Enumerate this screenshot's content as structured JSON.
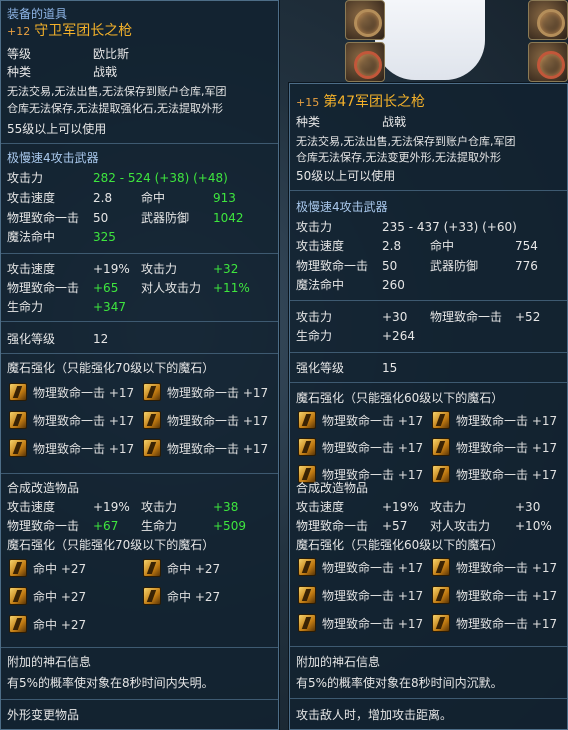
{
  "left": {
    "section_title": "装备的道具",
    "plus": "+12",
    "name": "守卫军团长之枪",
    "grade_label": "等级",
    "grade_value": "欧比斯",
    "type_label": "种类",
    "type_value": "战戟",
    "desc1": "无法交易,无法出售,无法保存到账户仓库,军团",
    "desc2": "仓库无法保存,无法提取强化石,无法提取外形",
    "level_req": "55级以上可以使用",
    "weapon_type": "极慢速4攻击武器",
    "stats1": [
      {
        "label": "攻击力",
        "value": "282 - 524 (+38) (+48)",
        "value2_label": "",
        "value2": ""
      },
      {
        "label": "攻击速度",
        "value": "2.8",
        "value2_label": "命中",
        "value2": "913"
      },
      {
        "label": "物理致命一击",
        "value": "50",
        "value2_label": "武器防御",
        "value2": "1042"
      },
      {
        "label": "魔法命中",
        "value": "325",
        "value2_label": "",
        "value2": ""
      }
    ],
    "bonus": [
      {
        "l1": "攻击速度",
        "v1": "+19%",
        "l2": "攻击力",
        "v2": "+32"
      },
      {
        "l1": "物理致命一击",
        "v1": "+65",
        "l2": "对人攻击力",
        "v2": "+11%"
      },
      {
        "l1": "生命力",
        "v1": "+347",
        "l2": "",
        "v2": ""
      }
    ],
    "enchant_label": "强化等级",
    "enchant_value": "12",
    "stone_header": "魔石强化（只能强化70级以下的魔石）",
    "stones": [
      "物理致命一击 +17",
      "物理致命一击 +17",
      "物理致命一击 +17",
      "物理致命一击 +17",
      "物理致命一击 +17",
      "物理致命一击 +17"
    ],
    "fusion_header": "合成改造物品",
    "fusion_bonus": [
      {
        "l1": "攻击速度",
        "v1": "+19%",
        "l2": "攻击力",
        "v2": "+38"
      },
      {
        "l1": "物理致命一击",
        "v1": "+67",
        "l2": "生命力",
        "v2": "+509"
      }
    ],
    "fusion_stone_header": "魔石强化（只能强化70级以下的魔石）",
    "fusion_stones": [
      "命中 +27",
      "命中 +27",
      "命中 +27",
      "命中 +27",
      "命中 +27"
    ],
    "godstone_header": "附加的神石信息",
    "godstone_desc": "有5%的概率使对象在8秒时间内失明。",
    "skin_header": "外形变更物品"
  },
  "right": {
    "plus": "+15",
    "name": "第47军团长之枪",
    "type_label": "种类",
    "type_value": "战戟",
    "desc1": "无法交易,无法出售,无法保存到账户仓库,军团",
    "desc2": "仓库无法保存,无法变更外形,无法提取外形",
    "level_req": "50级以上可以使用",
    "weapon_type": "极慢速4攻击武器",
    "stats1": [
      {
        "label": "攻击力",
        "value": "235 - 437 (+33) (+60)",
        "value2_label": "",
        "value2": ""
      },
      {
        "label": "攻击速度",
        "value": "2.8",
        "value2_label": "命中",
        "value2": "754"
      },
      {
        "label": "物理致命一击",
        "value": "50",
        "value2_label": "武器防御",
        "value2": "776"
      },
      {
        "label": "魔法命中",
        "value": "260",
        "value2_label": "",
        "value2": ""
      }
    ],
    "bonus": [
      {
        "l1": "攻击力",
        "v1": "+30",
        "l2": "物理致命一击",
        "v2": "+52"
      },
      {
        "l1": "生命力",
        "v1": "+264",
        "l2": "",
        "v2": ""
      }
    ],
    "enchant_label": "强化等级",
    "enchant_value": "15",
    "stone_header": "魔石强化（只能强化60级以下的魔石）",
    "stones": [
      "物理致命一击 +17",
      "物理致命一击 +17",
      "物理致命一击 +17",
      "物理致命一击 +17",
      "物理致命一击 +17",
      "物理致命一击 +17"
    ],
    "fusion_header": "合成改造物品",
    "fusion_bonus": [
      {
        "l1": "攻击速度",
        "v1": "+19%",
        "l2": "攻击力",
        "v2": "+30"
      },
      {
        "l1": "物理致命一击",
        "v1": "+57",
        "l2": "对人攻击力",
        "v2": "+10%"
      }
    ],
    "fusion_stone_header": "魔石强化（只能强化60级以下的魔石）",
    "fusion_stones": [
      "物理致命一击 +17",
      "物理致命一击 +17",
      "物理致命一击 +17",
      "物理致命一击 +17",
      "物理致命一击 +17",
      "物理致命一击 +17"
    ],
    "godstone_header": "附加的神石信息",
    "godstone_desc": "有5%的概率使对象在8秒时间内沉默。",
    "skin_desc": "攻击敌人时，增加攻击距离。"
  }
}
